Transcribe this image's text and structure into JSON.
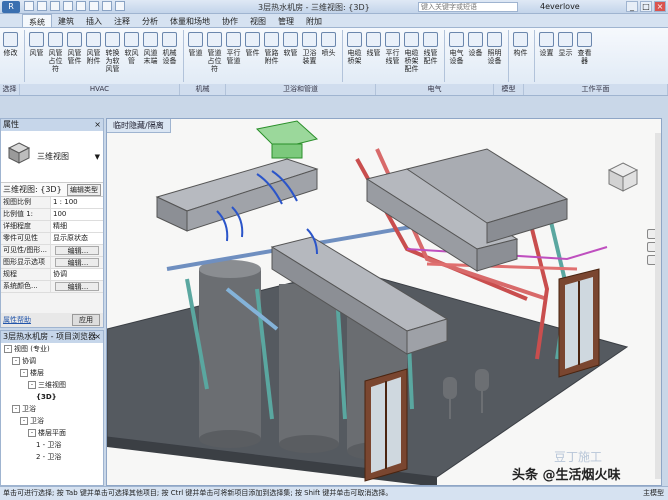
{
  "titlebar": {
    "app_label": "R",
    "title": "3层热水机房 - 三维视图: {3D}",
    "search_placeholder": "键入关键字或短语",
    "user": "4everlove"
  },
  "tabs": [
    "系统",
    "建筑",
    "插入",
    "注释",
    "分析",
    "体量和场地",
    "协作",
    "视图",
    "管理",
    "附加"
  ],
  "active_tab": 0,
  "tools": [
    {
      "label": "修改"
    },
    {
      "label": "风管"
    },
    {
      "label": "风管占位符"
    },
    {
      "label": "风管管件"
    },
    {
      "label": "风管附件"
    },
    {
      "label": "转换为软风管"
    },
    {
      "label": "软风管"
    },
    {
      "label": "风道末端"
    },
    {
      "label": "机械设备"
    },
    {
      "label": "管道"
    },
    {
      "label": "管道占位符"
    },
    {
      "label": "平行管道"
    },
    {
      "label": "管件"
    },
    {
      "label": "管路附件"
    },
    {
      "label": "软管"
    },
    {
      "label": "卫浴装置"
    },
    {
      "label": "喷头"
    },
    {
      "label": "电缆桥架"
    },
    {
      "label": "线管"
    },
    {
      "label": "平行线管"
    },
    {
      "label": "电缆桥架配件"
    },
    {
      "label": "线管配件"
    },
    {
      "label": "电气设备"
    },
    {
      "label": "设备"
    },
    {
      "label": "照明设备"
    },
    {
      "label": "构件"
    },
    {
      "label": "设置"
    },
    {
      "label": "显示"
    },
    {
      "label": "查看器"
    }
  ],
  "panels": [
    {
      "label": "选择"
    },
    {
      "label": "HVAC"
    },
    {
      "label": "机械"
    },
    {
      "label": "卫浴和管道"
    },
    {
      "label": "电气"
    },
    {
      "label": "模型"
    },
    {
      "label": "工作平面"
    }
  ],
  "properties": {
    "header": "属性",
    "type_name": "三维视图",
    "selector": "三维视图: {3D}",
    "edit_type": "编辑类型",
    "rows": [
      {
        "key": "视图比例",
        "value": "1 : 100"
      },
      {
        "key": "比例值 1:",
        "value": "100"
      },
      {
        "key": "详细程度",
        "value": "精细"
      },
      {
        "key": "零件可见性",
        "value": "显示原状态"
      },
      {
        "key": "可见性/图形...",
        "value": "编辑..."
      },
      {
        "key": "图形显示选项",
        "value": "编辑..."
      },
      {
        "key": "规程",
        "value": "协调"
      },
      {
        "key": "系统颜色...",
        "value": "编辑..."
      }
    ],
    "help_link": "属性帮助",
    "apply": "应用"
  },
  "browser": {
    "header": "3层热水机房 - 项目浏览器",
    "nodes": [
      {
        "label": "视图 (专业)",
        "level": 0,
        "toggle": "-"
      },
      {
        "label": "协调",
        "level": 1,
        "toggle": "-"
      },
      {
        "label": "楼层",
        "level": 2,
        "toggle": "-"
      },
      {
        "label": "三维视图",
        "level": 3,
        "toggle": "-"
      },
      {
        "label": "{3D}",
        "level": 4,
        "toggle": "",
        "selected": true
      },
      {
        "label": "卫浴",
        "level": 1,
        "toggle": "-"
      },
      {
        "label": "卫浴",
        "level": 2,
        "toggle": "-"
      },
      {
        "label": "楼层平面",
        "level": 3,
        "toggle": "-"
      },
      {
        "label": "1 - 卫浴",
        "level": 4,
        "toggle": ""
      },
      {
        "label": "2 - 卫浴",
        "level": 4,
        "toggle": ""
      }
    ]
  },
  "viewport": {
    "tab_label": "临时隐藏/隔离"
  },
  "status": {
    "text": "单击可进行选择; 按 Tab 键并单击可选择其他项目; 按 Ctrl 键并单击可将新项目添加到选择集; 按 Shift 键并单击可取消选择。",
    "right": "主模型"
  },
  "watermark": {
    "text": "头条 @生活烟火味",
    "brand": "豆丁施工"
  }
}
